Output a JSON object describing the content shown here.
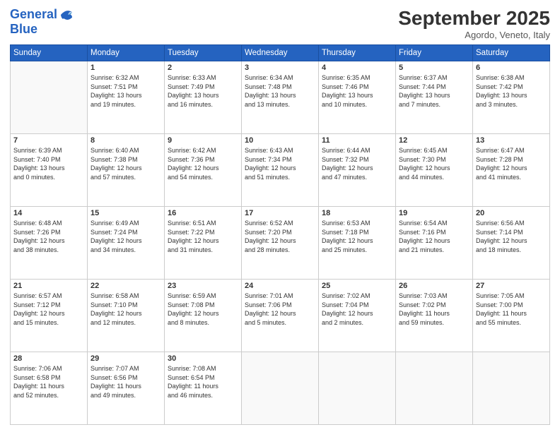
{
  "logo": {
    "line1": "General",
    "line2": "Blue"
  },
  "title": "September 2025",
  "location": "Agordo, Veneto, Italy",
  "days_of_week": [
    "Sunday",
    "Monday",
    "Tuesday",
    "Wednesday",
    "Thursday",
    "Friday",
    "Saturday"
  ],
  "weeks": [
    [
      {
        "day": "",
        "info": ""
      },
      {
        "day": "1",
        "info": "Sunrise: 6:32 AM\nSunset: 7:51 PM\nDaylight: 13 hours\nand 19 minutes."
      },
      {
        "day": "2",
        "info": "Sunrise: 6:33 AM\nSunset: 7:49 PM\nDaylight: 13 hours\nand 16 minutes."
      },
      {
        "day": "3",
        "info": "Sunrise: 6:34 AM\nSunset: 7:48 PM\nDaylight: 13 hours\nand 13 minutes."
      },
      {
        "day": "4",
        "info": "Sunrise: 6:35 AM\nSunset: 7:46 PM\nDaylight: 13 hours\nand 10 minutes."
      },
      {
        "day": "5",
        "info": "Sunrise: 6:37 AM\nSunset: 7:44 PM\nDaylight: 13 hours\nand 7 minutes."
      },
      {
        "day": "6",
        "info": "Sunrise: 6:38 AM\nSunset: 7:42 PM\nDaylight: 13 hours\nand 3 minutes."
      }
    ],
    [
      {
        "day": "7",
        "info": "Sunrise: 6:39 AM\nSunset: 7:40 PM\nDaylight: 13 hours\nand 0 minutes."
      },
      {
        "day": "8",
        "info": "Sunrise: 6:40 AM\nSunset: 7:38 PM\nDaylight: 12 hours\nand 57 minutes."
      },
      {
        "day": "9",
        "info": "Sunrise: 6:42 AM\nSunset: 7:36 PM\nDaylight: 12 hours\nand 54 minutes."
      },
      {
        "day": "10",
        "info": "Sunrise: 6:43 AM\nSunset: 7:34 PM\nDaylight: 12 hours\nand 51 minutes."
      },
      {
        "day": "11",
        "info": "Sunrise: 6:44 AM\nSunset: 7:32 PM\nDaylight: 12 hours\nand 47 minutes."
      },
      {
        "day": "12",
        "info": "Sunrise: 6:45 AM\nSunset: 7:30 PM\nDaylight: 12 hours\nand 44 minutes."
      },
      {
        "day": "13",
        "info": "Sunrise: 6:47 AM\nSunset: 7:28 PM\nDaylight: 12 hours\nand 41 minutes."
      }
    ],
    [
      {
        "day": "14",
        "info": "Sunrise: 6:48 AM\nSunset: 7:26 PM\nDaylight: 12 hours\nand 38 minutes."
      },
      {
        "day": "15",
        "info": "Sunrise: 6:49 AM\nSunset: 7:24 PM\nDaylight: 12 hours\nand 34 minutes."
      },
      {
        "day": "16",
        "info": "Sunrise: 6:51 AM\nSunset: 7:22 PM\nDaylight: 12 hours\nand 31 minutes."
      },
      {
        "day": "17",
        "info": "Sunrise: 6:52 AM\nSunset: 7:20 PM\nDaylight: 12 hours\nand 28 minutes."
      },
      {
        "day": "18",
        "info": "Sunrise: 6:53 AM\nSunset: 7:18 PM\nDaylight: 12 hours\nand 25 minutes."
      },
      {
        "day": "19",
        "info": "Sunrise: 6:54 AM\nSunset: 7:16 PM\nDaylight: 12 hours\nand 21 minutes."
      },
      {
        "day": "20",
        "info": "Sunrise: 6:56 AM\nSunset: 7:14 PM\nDaylight: 12 hours\nand 18 minutes."
      }
    ],
    [
      {
        "day": "21",
        "info": "Sunrise: 6:57 AM\nSunset: 7:12 PM\nDaylight: 12 hours\nand 15 minutes."
      },
      {
        "day": "22",
        "info": "Sunrise: 6:58 AM\nSunset: 7:10 PM\nDaylight: 12 hours\nand 12 minutes."
      },
      {
        "day": "23",
        "info": "Sunrise: 6:59 AM\nSunset: 7:08 PM\nDaylight: 12 hours\nand 8 minutes."
      },
      {
        "day": "24",
        "info": "Sunrise: 7:01 AM\nSunset: 7:06 PM\nDaylight: 12 hours\nand 5 minutes."
      },
      {
        "day": "25",
        "info": "Sunrise: 7:02 AM\nSunset: 7:04 PM\nDaylight: 12 hours\nand 2 minutes."
      },
      {
        "day": "26",
        "info": "Sunrise: 7:03 AM\nSunset: 7:02 PM\nDaylight: 11 hours\nand 59 minutes."
      },
      {
        "day": "27",
        "info": "Sunrise: 7:05 AM\nSunset: 7:00 PM\nDaylight: 11 hours\nand 55 minutes."
      }
    ],
    [
      {
        "day": "28",
        "info": "Sunrise: 7:06 AM\nSunset: 6:58 PM\nDaylight: 11 hours\nand 52 minutes."
      },
      {
        "day": "29",
        "info": "Sunrise: 7:07 AM\nSunset: 6:56 PM\nDaylight: 11 hours\nand 49 minutes."
      },
      {
        "day": "30",
        "info": "Sunrise: 7:08 AM\nSunset: 6:54 PM\nDaylight: 11 hours\nand 46 minutes."
      },
      {
        "day": "",
        "info": ""
      },
      {
        "day": "",
        "info": ""
      },
      {
        "day": "",
        "info": ""
      },
      {
        "day": "",
        "info": ""
      }
    ]
  ]
}
